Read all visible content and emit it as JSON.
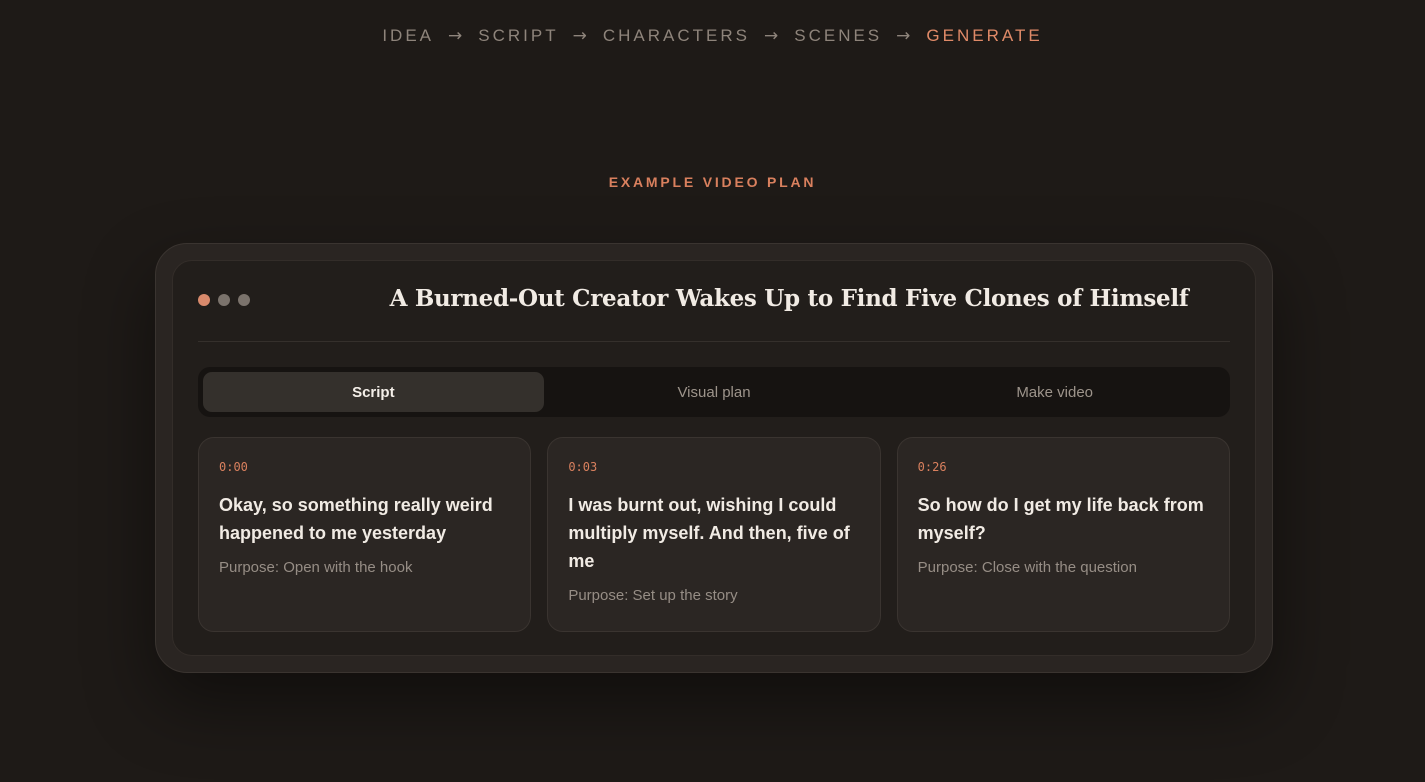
{
  "pipeline": {
    "steps": [
      {
        "label": "IDEA",
        "active": false
      },
      {
        "label": "SCRIPT",
        "active": false
      },
      {
        "label": "CHARACTERS",
        "active": false
      },
      {
        "label": "SCENES",
        "active": false
      },
      {
        "label": "GENERATE",
        "active": true
      }
    ],
    "separator": "→"
  },
  "section_label": "EXAMPLE VIDEO PLAN",
  "plan": {
    "title": "A Burned-Out Creator Wakes Up to Find Five Clones of Himself",
    "tabs": [
      {
        "label": "Script",
        "active": true
      },
      {
        "label": "Visual plan",
        "active": false
      },
      {
        "label": "Make video",
        "active": false
      }
    ],
    "cards": [
      {
        "time": "0:00",
        "line": "Okay, so something really weird happened to me yesterday",
        "purpose": "Purpose: Open with the hook"
      },
      {
        "time": "0:03",
        "line": "I was burnt out, wishing I could multiply myself. And then, five of me",
        "purpose": "Purpose: Set up the story"
      },
      {
        "time": "0:26",
        "line": "So how do I get my life back from myself?",
        "purpose": "Purpose: Close with the question"
      }
    ]
  },
  "colors": {
    "background": "#1e1a17",
    "accent": "#d9805e",
    "text": "#f1ebe4",
    "muted": "#968d85"
  }
}
